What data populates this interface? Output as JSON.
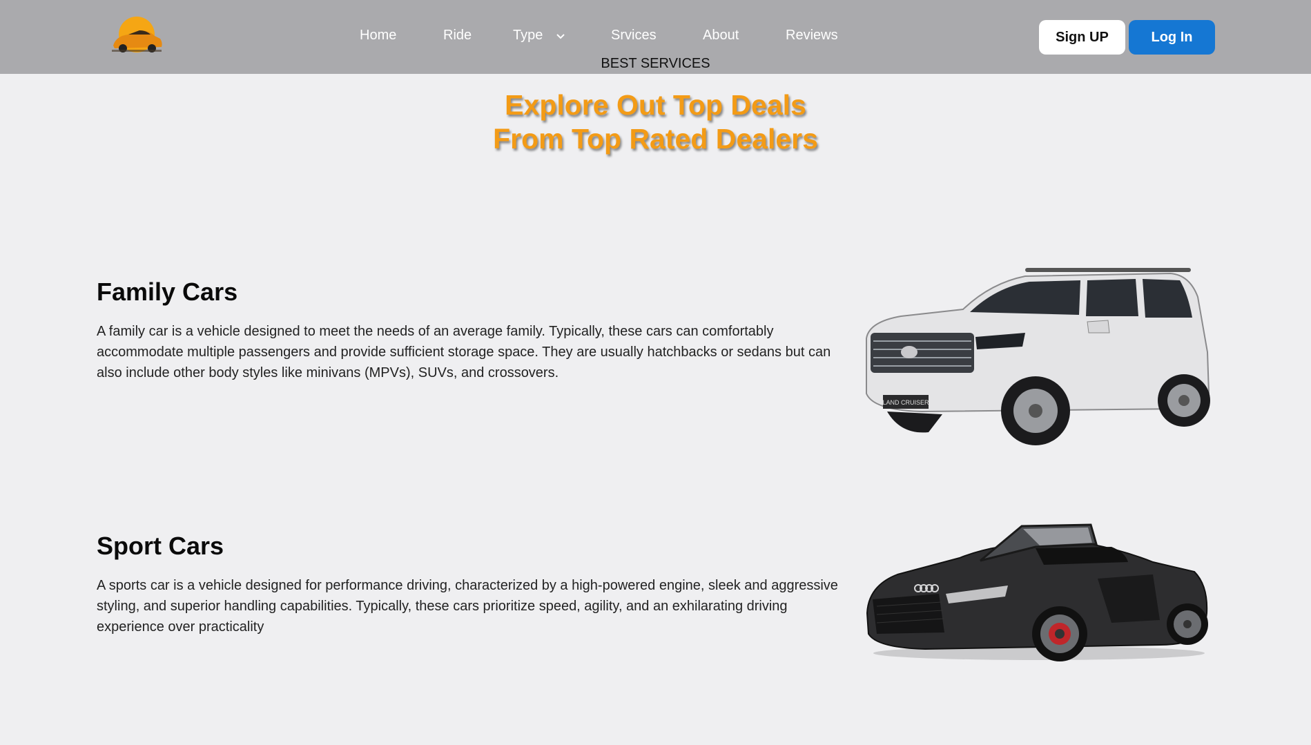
{
  "nav": {
    "logo_icon": "car-sunset-logo-icon",
    "links": [
      {
        "label": "Home"
      },
      {
        "label": "Ride"
      },
      {
        "label": "Type"
      },
      {
        "label": "Srvices"
      },
      {
        "label": "About"
      },
      {
        "label": "Reviews"
      }
    ],
    "type_dropdown_icon": "chevron-down-icon",
    "sub_caption": "BEST SERVICES",
    "signup_label": "Sign UP",
    "login_label": "Log In"
  },
  "hero": {
    "title_line1": "Explore Out Top Deals",
    "title_line2": "From Top Rated Dealers"
  },
  "sections": [
    {
      "heading": "Family Cars",
      "text": "A family car is a vehicle designed to meet the needs of an average family. Typically, these cars can comfortably accommodate multiple passengers and provide sufficient storage space. They are usually hatchbacks or sedans but can also include other body styles like minivans (MPVs), SUVs, and crossovers.",
      "image": "white-suv-image",
      "plate": "LAND CRUISER"
    },
    {
      "heading": "Sport Cars",
      "text": "A sports car is a vehicle designed for performance driving, characterized by a high-powered engine, sleek and aggressive styling, and superior handling capabilities. Typically, these cars prioritize speed, agility, and an exhilarating driving experience over practicality",
      "image": "black-convertible-image"
    }
  ],
  "colors": {
    "navbar_bg": "#aaaaad",
    "page_bg": "#efeff1",
    "accent_orange": "#f39b16",
    "login_blue": "#1577d3"
  }
}
